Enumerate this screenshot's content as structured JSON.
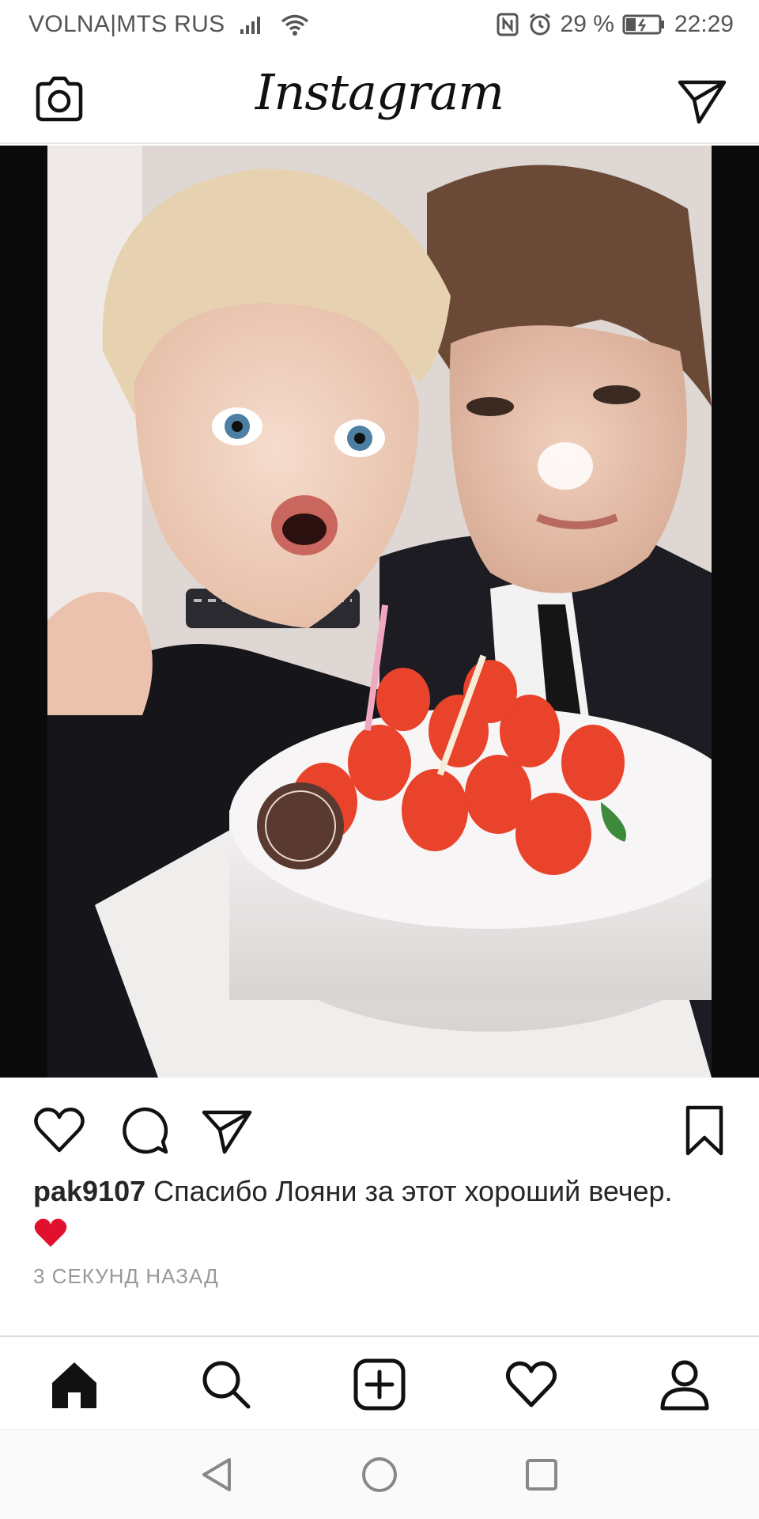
{
  "status_bar": {
    "carrier": "VOLNA|MTS RUS",
    "battery": "29 %",
    "time": "22:29"
  },
  "header": {
    "logo": "Instagram",
    "left_icon": "camera-icon",
    "right_icon": "direct-send-icon"
  },
  "post": {
    "image_icon": "post-photo",
    "actions": [
      "like-heart-icon",
      "comment-icon",
      "share-send-icon",
      "save-bookmark-icon"
    ],
    "username": "pak9107",
    "caption_text": "Спасибо Лояни за этот хороший вечер.",
    "caption_emoji": "❤️",
    "timestamp": "3 СЕКУНД НАЗАД"
  },
  "tab_bar": {
    "items": [
      "home-icon",
      "search-icon",
      "new-post-icon",
      "activity-heart-icon",
      "profile-icon"
    ]
  },
  "system_nav": {
    "items": [
      "back-icon",
      "home-circle-icon",
      "recents-icon"
    ]
  },
  "colors": {
    "text": "#262626",
    "muted": "#999999",
    "heart_red": "#e0102e"
  }
}
